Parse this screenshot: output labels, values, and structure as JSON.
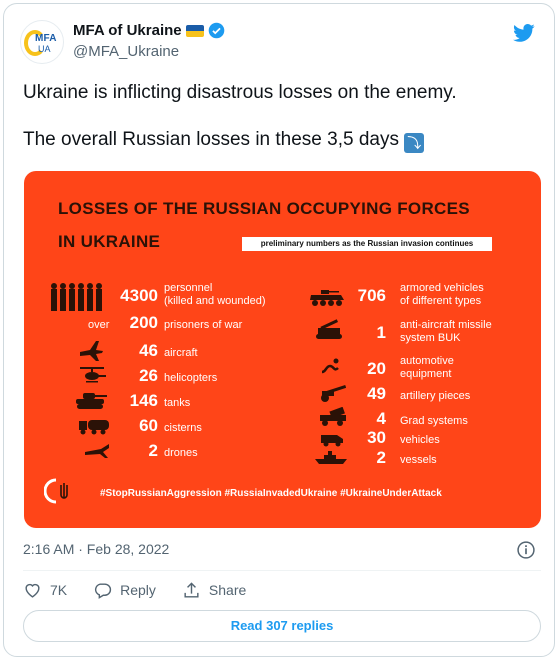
{
  "account": {
    "name": "MFA of Ukraine",
    "handle": "@MFA_Ukraine",
    "avatar_text_top": "MFA",
    "avatar_text_bottom": "UA"
  },
  "tweet": {
    "line1": "Ukraine is inflicting disastrous losses on the enemy.",
    "line2": "The overall Russian losses in these 3,5 days",
    "emoji": "⤵",
    "timestamp": "2:16 AM · Feb 28, 2022"
  },
  "infographic": {
    "title_line1": "LOSSES OF THE RUSSIAN OCCUPYING FORCES",
    "title_line2": "IN UKRAINE",
    "subtitle": "preliminary numbers as the Russian invasion continues",
    "left_items": [
      {
        "value": "4300",
        "label": "personnel",
        "label2": "(killed and wounded)",
        "icon": "soldiers-icon"
      },
      {
        "prefix": "over",
        "value": "200",
        "label": "prisoners of war",
        "icon": ""
      },
      {
        "value": "46",
        "label": "aircraft",
        "icon": "aircraft-icon"
      },
      {
        "value": "26",
        "label": "helicopters",
        "icon": "helicopter-icon"
      },
      {
        "value": "146",
        "label": "tanks",
        "icon": "tank-icon"
      },
      {
        "value": "60",
        "label": "cisterns",
        "icon": "cistern-icon"
      },
      {
        "value": "2",
        "label": "drones",
        "icon": "drone-icon"
      }
    ],
    "right_items": [
      {
        "value": "706",
        "label": "armored vehicles",
        "label2": "of different types",
        "icon": "armored-vehicle-icon"
      },
      {
        "value": "1",
        "label": "anti-aircraft missile",
        "label2": "system BUK",
        "icon": "missile-system-icon"
      },
      {
        "value": "20",
        "label": "automotive",
        "label2": "equipment",
        "icon": "automotive-icon"
      },
      {
        "value": "49",
        "label": "artillery pieces",
        "icon": "artillery-icon"
      },
      {
        "value": "4",
        "label": "Grad systems",
        "icon": "grad-icon"
      },
      {
        "value": "30",
        "label": "vehicles",
        "icon": "vehicle-icon"
      },
      {
        "value": "2",
        "label": "vessels",
        "icon": "vessel-icon"
      }
    ],
    "hashtags": "#StopRussianAggression #RussiaInvadedUkraine #UkraineUnderAttack"
  },
  "actions": {
    "likes": "7K",
    "reply_label": "Reply",
    "share_label": "Share",
    "read_replies": "Read 307 replies"
  },
  "colors": {
    "accent": "#1d9bf0",
    "infographic_bg": "#ff4518",
    "muted": "#536471"
  }
}
